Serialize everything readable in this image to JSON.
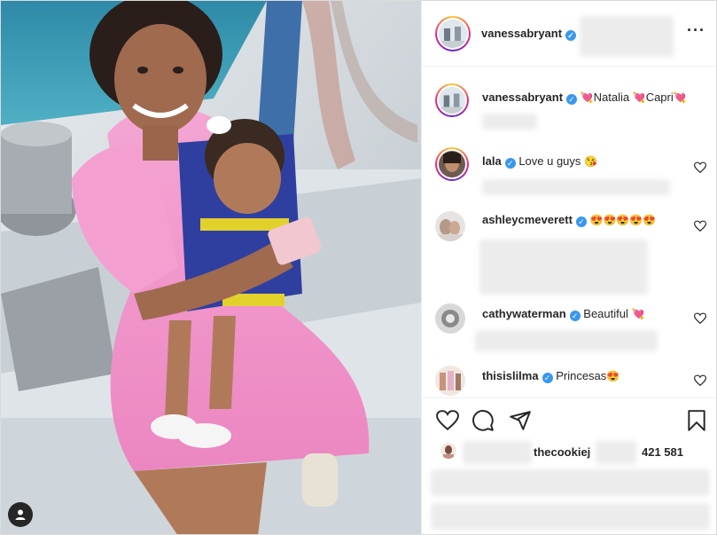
{
  "post": {
    "author": "vanessabryant",
    "caption_emoji_1": "💘",
    "caption_name_1": "Natalia",
    "caption_emoji_2": "💘",
    "caption_name_2": "Capri",
    "caption_emoji_3": "💘"
  },
  "comments": [
    {
      "user": "lala",
      "text": "Love u guys",
      "emoji": "😘"
    },
    {
      "user": "ashleycmeverett",
      "text": "",
      "emoji": "😍😍😍😍😍"
    },
    {
      "user": "cathywaterman",
      "text": "Beautiful",
      "emoji": "💘"
    },
    {
      "user": "thisislilma",
      "text": "Princesas",
      "emoji": "😍"
    }
  ],
  "likes": {
    "liker": "thecookiej",
    "count": "421 581"
  },
  "icons": {
    "more": "more-options-icon",
    "like": "heart-icon",
    "comment": "comment-icon",
    "share": "share-icon",
    "save": "bookmark-icon",
    "tag": "user-tag-icon",
    "verified": "verified-badge-icon"
  },
  "colors": {
    "verified": "#3897f0",
    "text": "#262626",
    "border": "#dbdbdb"
  }
}
